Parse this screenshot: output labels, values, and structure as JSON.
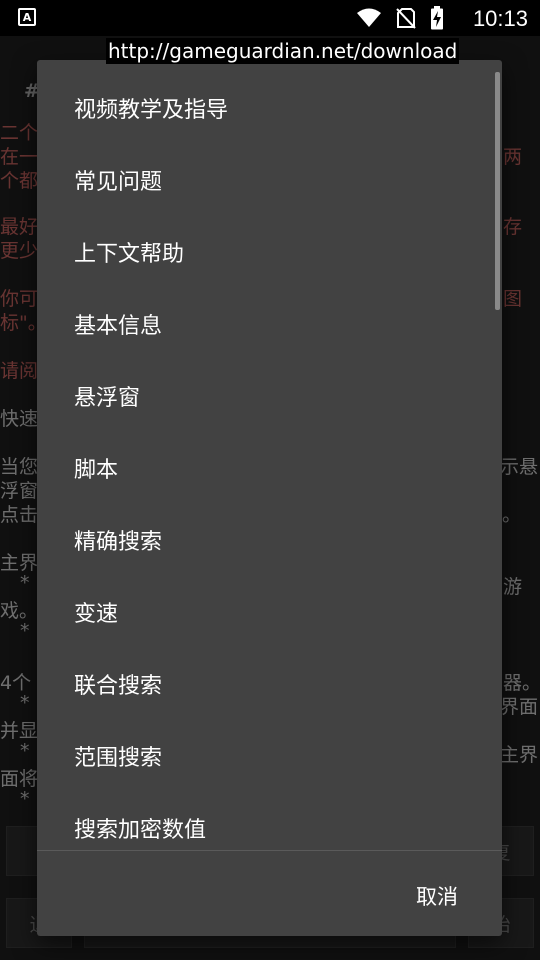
{
  "status_bar": {
    "time": "10:13",
    "left_icon": "A",
    "icons": [
      "wifi-icon",
      "no-sim-icon",
      "battery-charging-icon"
    ]
  },
  "overlay_url": "http://gameguardian.net/download",
  "background": {
    "lines": [
      {
        "text": "#",
        "red": false
      },
      {
        "text": "二个",
        "red": true
      },
      {
        "text": "在一",
        "red": true
      },
      {
        "text": "两",
        "red": true
      },
      {
        "text": "个都",
        "red": true
      },
      {
        "text": "最好",
        "red": true
      },
      {
        "text": "存",
        "red": true
      },
      {
        "text": "更少",
        "red": true
      },
      {
        "text": "你可",
        "red": true
      },
      {
        "text": "图",
        "red": true
      },
      {
        "text": "标\"。",
        "red": true
      },
      {
        "text": "请阅",
        "red": true
      },
      {
        "text": "快速",
        "red": false
      },
      {
        "text": "当您",
        "red": false
      },
      {
        "text": "示悬",
        "red": false
      },
      {
        "text": "浮窗",
        "red": false
      },
      {
        "text": "点击",
        "red": false
      },
      {
        "text": "。",
        "red": false
      },
      {
        "text": "主界",
        "red": false
      },
      {
        "text": "* ",
        "red": false
      },
      {
        "text": "游",
        "red": false
      },
      {
        "text": "戏。",
        "red": false
      },
      {
        "text": "* ",
        "red": false
      },
      {
        "text": "4个",
        "red": false
      },
      {
        "text": "器。",
        "red": false
      },
      {
        "text": "* ",
        "red": false
      },
      {
        "text": "界面",
        "red": false
      },
      {
        "text": "并显",
        "red": false
      },
      {
        "text": "* ",
        "red": false
      },
      {
        "text": "主界",
        "red": false
      },
      {
        "text": "面将",
        "red": false
      },
      {
        "text": "* ",
        "red": false
      }
    ],
    "buttons": {
      "restore": "复",
      "exit": "退",
      "start": "始"
    }
  },
  "dialog": {
    "items": [
      "视频教学及指导",
      "常见问题",
      "上下文帮助",
      "基本信息",
      "悬浮窗",
      "脚本",
      "精确搜索",
      "变速",
      "联合搜索",
      "范围搜索",
      "搜索加密数值"
    ],
    "cancel_label": "取消"
  }
}
